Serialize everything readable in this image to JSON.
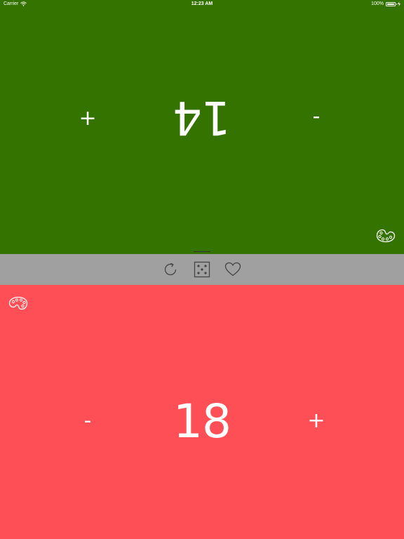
{
  "status_bar": {
    "carrier": "Carrier",
    "time": "12:23 AM",
    "battery": "100%",
    "battery_level": 1.0
  },
  "players": [
    {
      "score": "14",
      "minus_label": "-",
      "plus_label": "+",
      "color": "#347300",
      "icon": "palette-icon"
    },
    {
      "score": "18",
      "minus_label": "-",
      "plus_label": "+",
      "color": "#fe4f56",
      "icon": "palette-icon"
    }
  ],
  "toolbar": {
    "color": "#a0a0a0",
    "icons": [
      "refresh-icon",
      "dice-icon",
      "heart-icon"
    ]
  }
}
